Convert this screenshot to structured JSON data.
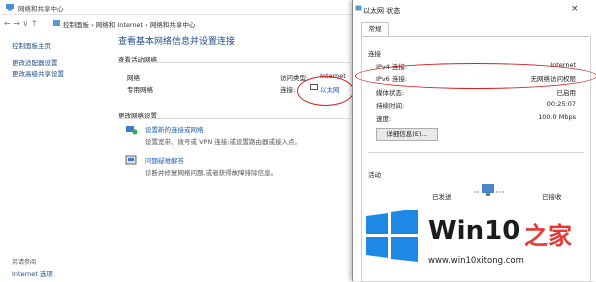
{
  "window": {
    "title": "网络和共享中心"
  },
  "address": {
    "nav_glyphs": "← → ∨ ↑",
    "breadcrumb": "控制面板 › 网络和 Internet › 网络和共享中心"
  },
  "sidebar": {
    "items": [
      {
        "label": "控制面板主页"
      },
      {
        "label": "更改适配器设置"
      },
      {
        "label": "更改高级共享设置"
      }
    ],
    "see_also_heading": "另请参阅",
    "see_also_link": "Internet 选项"
  },
  "main": {
    "heading": "查看基本网络信息并设置连接",
    "active_networks_label": "查看活动网络",
    "network_name": "网络",
    "network_type": "专用网络",
    "access_type_label": "访问类型:",
    "access_type_value": "Internet",
    "connections_label": "连接:",
    "connection_link": "以太网",
    "change_settings_heading": "更改网络设置",
    "task1_link": "设置新的连接或网络",
    "task1_desc": "设置宽带、拨号或 VPN 连接;或设置路由器或接入点。",
    "task2_link": "问题疑难解答",
    "task2_desc": "诊断并修复网络问题,或者获得故障排除信息。"
  },
  "dialog": {
    "title": "以太网 状态",
    "close_glyph": "×",
    "tab": "常规",
    "connection_heading": "连接",
    "rows": [
      {
        "label": "IPv4 连接:",
        "value": "Internet"
      },
      {
        "label": "IPv6 连接:",
        "value": "无网络访问权限"
      },
      {
        "label": "媒体状态:",
        "value": "已启用"
      },
      {
        "label": "持续时间:",
        "value": "00:25:07"
      },
      {
        "label": "速度:",
        "value": "100.0 Mbps"
      }
    ],
    "details_button": "详细信息(E)...",
    "activity_heading": "活动",
    "sent_label": "已发送",
    "received_label": "已接收"
  },
  "watermark": {
    "brand_main": "Win10",
    "brand_suffix": "之家",
    "url": "www.win10xitong.com"
  },
  "colors": {
    "link": "#1a5fb4",
    "annotation": "#d42020",
    "logo_blue": "#1e88e5",
    "logo_red": "#e53935"
  }
}
